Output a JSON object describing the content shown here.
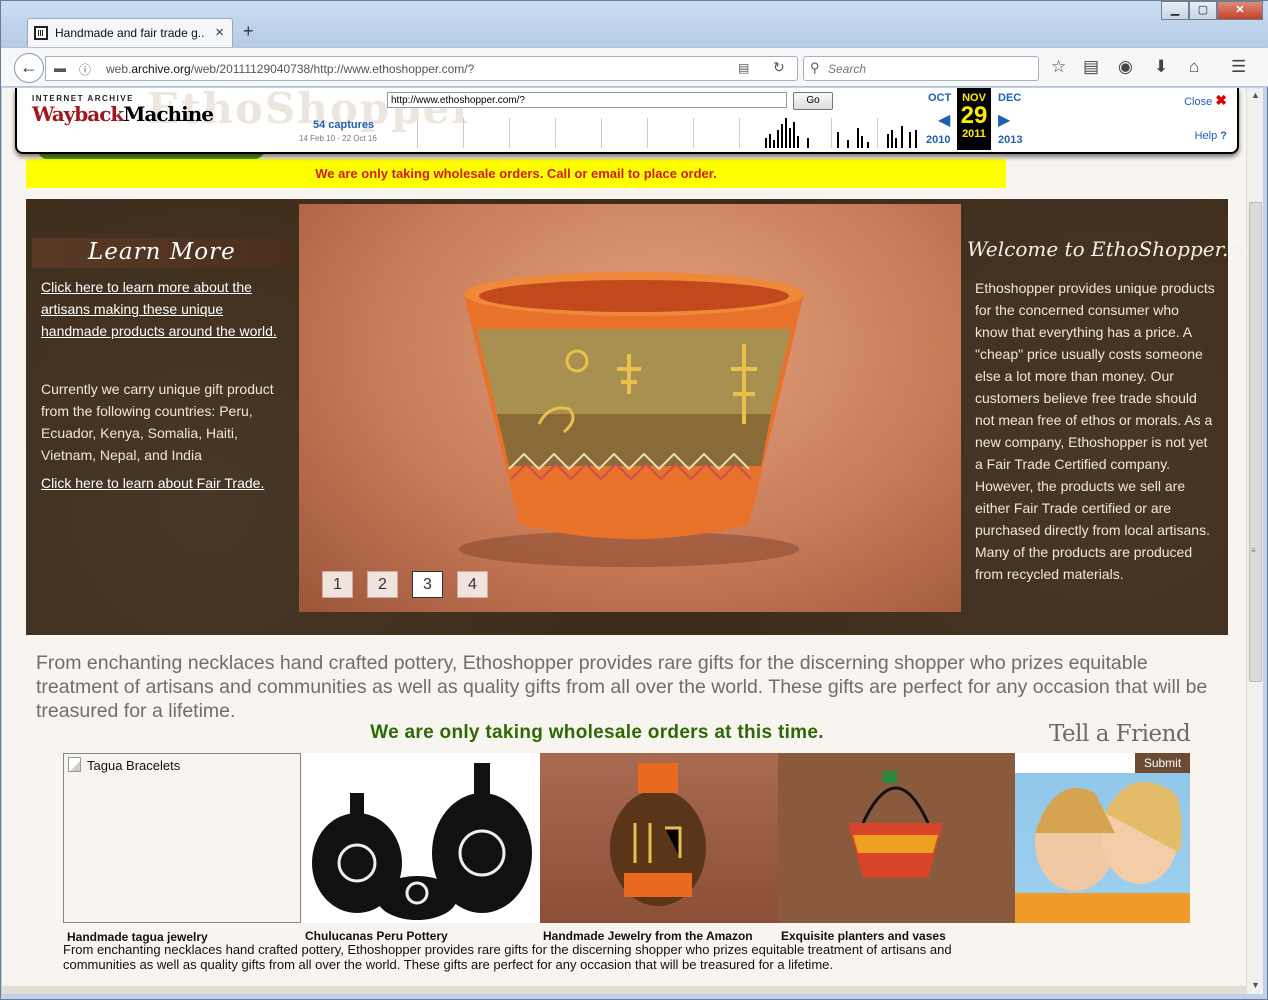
{
  "browser": {
    "tab_title": "Handmade and fair trade g...",
    "url_prefix": "web.",
    "url_domain": "archive.org",
    "url_rest": "/web/20111129040738/http://www.ethoshopper.com/?",
    "search_placeholder": "Search"
  },
  "wayback": {
    "logo_top": "INTERNET ARCHIVE",
    "logo_word": "Wayback",
    "logo_word2": "Machine",
    "ghost_logo": "EthoShopper",
    "url_value": "http://www.ethoshopper.com/?",
    "go_label": "Go",
    "captures": "54 captures",
    "capture_range": "14 Feb 10 - 22 Oct 16",
    "prev_month": "OCT",
    "cur_month": "NOV",
    "cur_day": "29",
    "next_month": "DEC",
    "prev_year": "2010",
    "cur_year": "2011",
    "next_year": "2013",
    "close_label": "Close",
    "help_label": "Help"
  },
  "banner": {
    "wholesale_notice": "We are only taking wholesale orders. Call or email to place order."
  },
  "learn_more": {
    "heading": "Learn More",
    "artisans_link": "Click here to learn more about the artisans making these unique handmade products around the world.",
    "countries_text": "Currently we carry unique gift product from the following countries: Peru, Ecuador, Kenya, Somalia, Haiti, Vietnam, Nepal, and India",
    "fairtrade_link": "Click here to learn about Fair Trade."
  },
  "slideshow": {
    "pages": [
      "1",
      "2",
      "3",
      "4"
    ],
    "active_index": 2
  },
  "welcome": {
    "heading": "Welcome to EthoShopper.com",
    "text": "Ethoshopper provides unique products for the concerned consumer who know that everything has a price. A \"cheap\" price usually costs someone else a lot more than money. Our customers believe free trade should not mean free of ethos or morals. As a new company, Ethoshopper is not yet a Fair Trade Certified company. However, the products we sell are either Fair Trade certified or are purchased directly from local artisans. Many of the products are produced from recycled materials."
  },
  "intro": "From enchanting necklaces hand crafted pottery, Ethoshopper provides rare gifts for the discerning shopper who prizes equitable treatment of artisans and communities as well as quality gifts from all over the world. These gifts are perfect for any occasion that will be treasured for a lifetime.",
  "wholesale_notice2": "We are only taking wholesale orders at this time.",
  "tell_a_friend": {
    "heading": "Tell a Friend",
    "submit_label": "Submit"
  },
  "products": [
    {
      "alt": "Tagua Bracelets",
      "caption": "Handmade tagua jewelry"
    },
    {
      "caption": "Chulucanas Peru Pottery"
    },
    {
      "caption": "Handmade Jewelry from the Amazon"
    },
    {
      "caption": "Exquisite planters and vases"
    }
  ],
  "footer_desc": "From enchanting necklaces hand crafted pottery, Ethoshopper provides rare gifts for the discerning shopper who prizes equitable treatment of artisans and communities as well as quality gifts from all over the world. These gifts are perfect for any occasion that will be treasured for a lifetime."
}
